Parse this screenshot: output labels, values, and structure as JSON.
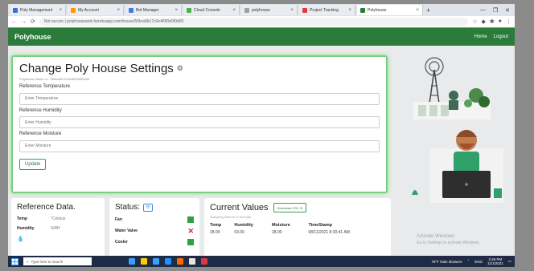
{
  "browser": {
    "tabs": [
      {
        "label": "Poly Management",
        "color": "#3b6fd8"
      },
      {
        "label": "My Account",
        "color": "#ff9800"
      },
      {
        "label": "Bot Manager",
        "color": "#3c7be0"
      },
      {
        "label": "Cloud Console",
        "color": "#4caf50"
      },
      {
        "label": "polyhouse",
        "color": "#a0a0a0"
      },
      {
        "label": "Project Tracking",
        "color": "#e23b3b"
      },
      {
        "label": "Polyhouse",
        "color": "#2b7b3b",
        "active": true
      }
    ],
    "new_tab": "+",
    "url": "Not secure | polyhouseweb.herokuapp.com/house/5f3ea9b17c0e4f0f0d0f0d00",
    "window_controls": [
      "—",
      "❐",
      "✕"
    ]
  },
  "navbar": {
    "brand": "Polyhouse",
    "home": "Home",
    "logout": "Logout"
  },
  "settings": {
    "title": "Change Poly House Settings",
    "subtitle": "Polyhouse Name: A - 5f3ea9b17c0e4f0f0d0f0d00",
    "fields": [
      {
        "label": "Reference Temperature",
        "placeholder": "Enter Temperature"
      },
      {
        "label": "Reference Humidity",
        "placeholder": "Enter Humidity"
      },
      {
        "label": "Reference Moisture",
        "placeholder": "Enter Moisture"
      }
    ],
    "update_label": "Update"
  },
  "reference": {
    "title": "Reference Data.",
    "rows": [
      {
        "label": "Temp",
        "value": "°Celsius"
      },
      {
        "label": "Humidity",
        "value": "%RH"
      }
    ]
  },
  "status": {
    "title": "Status:",
    "rows": [
      {
        "label": "Fan",
        "state": "on"
      },
      {
        "label": "Water Valve",
        "state": "off"
      },
      {
        "label": "Cooler",
        "state": "on"
      }
    ]
  },
  "current": {
    "title": "Current Values",
    "download_label": "Download CSV ⬇",
    "note": "Sampling interval: 5 seconds",
    "columns": [
      "Temp",
      "Humidity",
      "Moisture",
      "TimeStamp"
    ],
    "rows": [
      [
        "28.00",
        "63.00",
        "28.00",
        "08/11/2021 8:30:41 AM"
      ]
    ]
  },
  "watermark": {
    "line1": "Activate Windows",
    "line2": "Go to Settings to activate Windows."
  },
  "taskbar": {
    "search_placeholder": "Type here to search",
    "tray_weather": "79°F Rain showers",
    "tray_lang": "ENG",
    "time": "2:45 PM",
    "date": "11/1/2021",
    "app_colors": [
      "#3aa0ff",
      "#ffcc00",
      "#3aa0ff",
      "#1e90ff",
      "#ff6a00",
      "#e5e5e5",
      "#d83b3b"
    ]
  }
}
